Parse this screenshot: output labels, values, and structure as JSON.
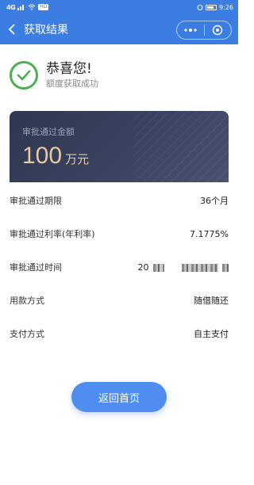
{
  "status_bar": {
    "signal": "4G",
    "badge": "HD",
    "time": "9:26"
  },
  "nav": {
    "title": "获取结果"
  },
  "success": {
    "title": "恭喜您!",
    "subtitle": "额度获取成功"
  },
  "card": {
    "label": "审批通过金额",
    "amount": "100",
    "unit": "万元"
  },
  "rows": [
    {
      "label": "审批通过期限",
      "value": "36个月"
    },
    {
      "label": "审批通过利率(年利率)",
      "value": "7.1775%"
    },
    {
      "label": "审批通过时间",
      "value": "20"
    },
    {
      "label": "用款方式",
      "value": "随借随还"
    },
    {
      "label": "支付方式",
      "value": "自主支付"
    }
  ],
  "button": {
    "label": "返回首页"
  },
  "colors": {
    "header": "#3b7de0",
    "success_green": "#4caf50",
    "card_gold": "#e9c7a0",
    "button": "#4f8ef0"
  },
  "icons": [
    "back-icon",
    "more-icon",
    "close-target-icon",
    "check-icon",
    "wifi-icon",
    "battery-icon",
    "alarm-icon"
  ]
}
